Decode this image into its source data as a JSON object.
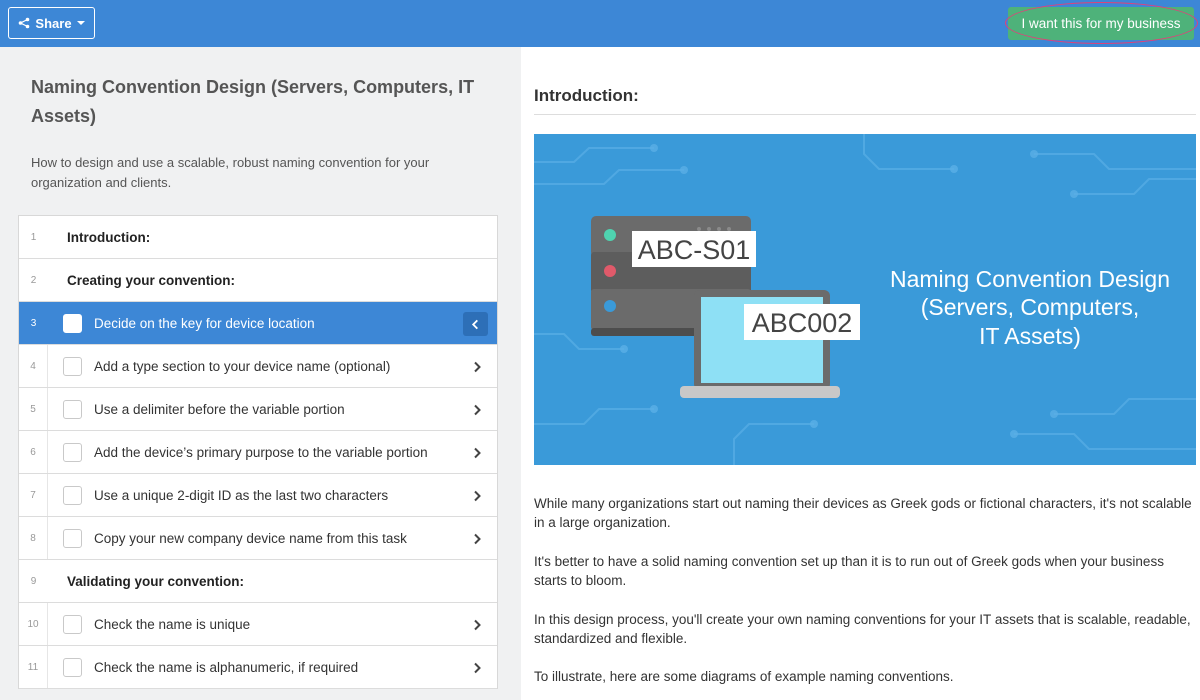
{
  "topbar": {
    "share_label": "Share",
    "cta_label": "I want this for my business"
  },
  "left": {
    "title": "Naming Convention Design (Servers, Computers, IT Assets)",
    "subtitle": "How to design and use a scalable, robust naming convention for your organization and clients."
  },
  "tasks": [
    {
      "num": "1",
      "label": "Introduction:",
      "heading": true
    },
    {
      "num": "2",
      "label": "Creating your convention:",
      "heading": true
    },
    {
      "num": "3",
      "label": "Decide on the key for device location",
      "active": true
    },
    {
      "num": "4",
      "label": "Add a type section to your device name (optional)"
    },
    {
      "num": "5",
      "label": "Use a delimiter before the variable portion"
    },
    {
      "num": "6",
      "label": "Add the device’s primary purpose to the variable portion"
    },
    {
      "num": "7",
      "label": "Use a unique 2-digit ID as the last two characters"
    },
    {
      "num": "8",
      "label": "Copy your new company device name from this task"
    },
    {
      "num": "9",
      "label": "Validating your convention:",
      "heading": true
    },
    {
      "num": "10",
      "label": "Check the name is unique"
    },
    {
      "num": "11",
      "label": "Check the name is alphanumeric, if required"
    }
  ],
  "main": {
    "section_title": "Introduction:",
    "banner": {
      "server_label": "ABC-S01",
      "laptop_label": "ABC002",
      "title_lines": [
        "Naming Convention Design",
        "(Servers, Computers,",
        "IT Assets)"
      ]
    },
    "paragraphs": [
      "While many organizations start out naming their devices as Greek gods or fictional characters, it's not scalable in a large organization.",
      "It's better to have a solid naming convention set up than it is to run out of Greek gods when your business starts to bloom.",
      "In this design process, you'll create your own naming conventions for your IT assets that is scalable, readable, standardized and flexible.",
      "To illustrate, here are some diagrams of example naming conventions."
    ]
  },
  "colors": {
    "topbar": "#3d87d6",
    "cta": "#4eb27a",
    "active_row": "#3d87d6",
    "banner": "#3a9ad9"
  }
}
